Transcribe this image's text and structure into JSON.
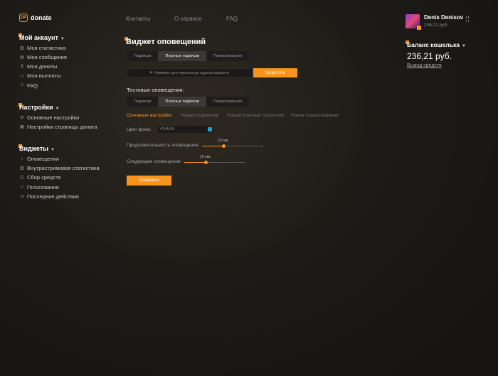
{
  "header": {
    "logo_text": "donate",
    "logo_mark": "DP",
    "nav": [
      "Контакты",
      "О сервисе",
      "FAQ"
    ],
    "user": {
      "name": "Denis Denisov",
      "balance": "236,21 руб."
    }
  },
  "sidebar": {
    "account": {
      "title": "Мой аккаунт",
      "items": [
        {
          "label": "Моя статистика",
          "icon": "chart-icon"
        },
        {
          "label": "Мои сообщения",
          "icon": "message-icon"
        },
        {
          "label": "Мои донаты",
          "icon": "dollar-icon"
        },
        {
          "label": "Мои выплаты",
          "icon": "wallet-icon"
        },
        {
          "label": "FAQ",
          "icon": "question-icon"
        }
      ]
    },
    "settings": {
      "title": "Настройки",
      "items": [
        {
          "label": "Основные настройки",
          "icon": "gear-icon"
        },
        {
          "label": "Настройки страницы доната",
          "icon": "page-icon"
        }
      ]
    },
    "widgets": {
      "title": "Виджеты",
      "items": [
        {
          "label": "Оповещения",
          "icon": "bell-icon"
        },
        {
          "label": "Внутристримовая статистика",
          "icon": "stats-icon"
        },
        {
          "label": "Сбор средств",
          "icon": "fund-icon"
        },
        {
          "label": "Голосования",
          "icon": "check-icon"
        },
        {
          "label": "Последние действия",
          "icon": "clock-icon"
        }
      ]
    }
  },
  "main": {
    "title": "Виджет оповещений",
    "top_tabs": [
      "Подписки",
      "Платные подписки",
      "Пожертвования"
    ],
    "url_placeholder": "Нажмите для просмотра адреса виджета",
    "launch_label": "Запустить",
    "test_title": "Тестовые оповещения:",
    "test_tabs": [
      "Подписки",
      "Платные подписки",
      "Пожертвования"
    ],
    "sub_tabs": [
      "Основные настройки",
      "Новый подписчик",
      "Новый платный подписчик",
      "Новое пожертвование"
    ],
    "bg_color_label": "Цвет фона:",
    "bg_color_value": "#fc4c9c",
    "duration_label": "Продолжительность оповещения:",
    "duration_value": "10 сек.",
    "duration_fraction": 0.35,
    "next_label": "Следующее оповещение:",
    "next_value": "10 сек.",
    "next_fraction": 0.35,
    "save_label": "Сохранить"
  },
  "wallet": {
    "title": "Баланс кошелька",
    "amount": "236,21 руб.",
    "withdraw": "Вывод средств"
  },
  "colors": {
    "accent": "#f7941d",
    "swatch": "#1f9fd1"
  }
}
